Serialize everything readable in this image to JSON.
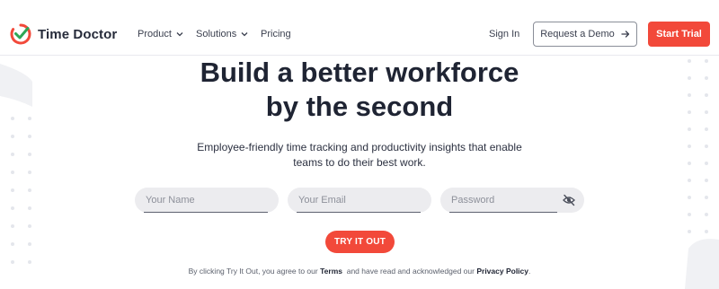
{
  "brand": {
    "name": "Time Doctor",
    "accent": "#f2493a",
    "check_color": "#2ea655"
  },
  "nav": {
    "items": [
      {
        "label": "Product",
        "icon": "chevron-down-icon"
      },
      {
        "label": "Solutions",
        "icon": "chevron-down-icon"
      },
      {
        "label": "Pricing"
      }
    ],
    "signin": "Sign In",
    "demo": {
      "label": "Request a Demo",
      "icon": "arrow-right-icon"
    },
    "trial": "Start Trial"
  },
  "hero": {
    "headline_line1": "Build a better workforce",
    "headline_line2": "by the second",
    "subtitle_line1": "Employee-friendly time tracking and productivity insights that enable",
    "subtitle_line2": "teams to do their best work."
  },
  "form": {
    "name_placeholder": "Your Name",
    "email_placeholder": "Your Email",
    "password_placeholder": "Password",
    "password_icon": "eye-off-icon",
    "submit": "TRY IT OUT"
  },
  "legal": {
    "prefix": "By clicking Try It Out, you agree to our",
    "terms": "Terms",
    "middle": "and have read and acknowledged our",
    "privacy": "Privacy Policy",
    "suffix": "."
  }
}
